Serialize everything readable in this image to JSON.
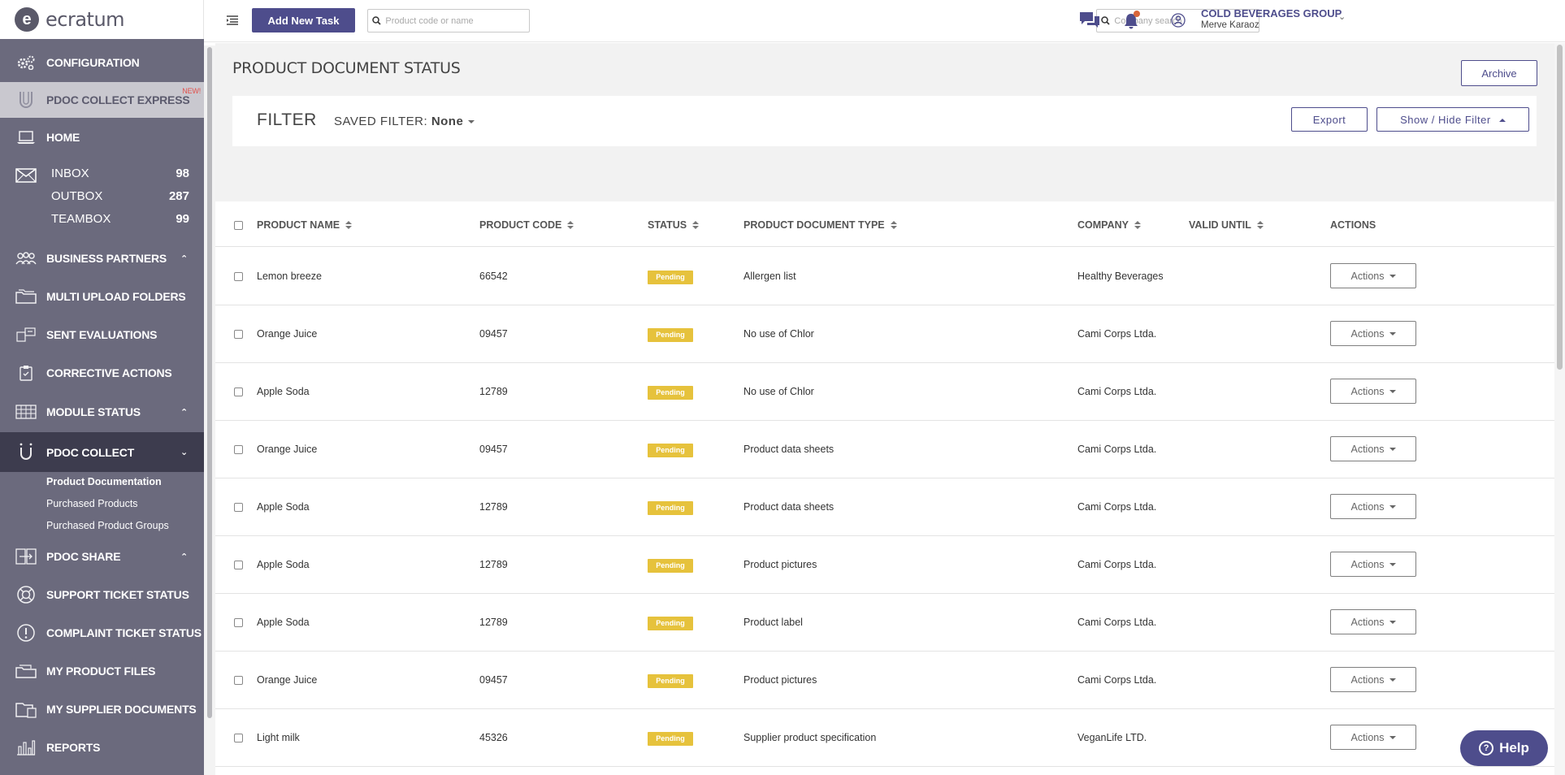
{
  "brand": {
    "logo_letter": "e",
    "logo_text": "ecratum"
  },
  "sidebar": {
    "configuration": "CONFIGURATION",
    "pdoc_express": "PDOC COLLECT EXPRESS",
    "new_badge": "NEW!",
    "home": "HOME",
    "inbox": {
      "label": "INBOX",
      "count": "98"
    },
    "outbox": {
      "label": "OUTBOX",
      "count": "287"
    },
    "teambox": {
      "label": "TEAMBOX",
      "count": "99"
    },
    "business_partners": "BUSINESS PARTNERS",
    "multi_upload": "MULTI UPLOAD FOLDERS",
    "sent_evaluations": "SENT EVALUATIONS",
    "corrective_actions": "CORRECTIVE ACTIONS",
    "module_status": "MODULE STATUS",
    "pdoc_collect": "PDOC COLLECT",
    "sub_product_documentation": "Product Documentation",
    "sub_purchased_products": "Purchased Products",
    "sub_purchased_product_groups": "Purchased Product Groups",
    "pdoc_share": "PDOC SHARE",
    "support_ticket": "SUPPORT TICKET STATUS",
    "complaint_ticket": "COMPLAINT TICKET STATUS",
    "my_product_files": "MY PRODUCT FILES",
    "my_supplier_documents": "MY SUPPLIER DOCUMENTS",
    "reports": "REPORTS"
  },
  "topbar": {
    "add_task": "Add New Task",
    "product_search_placeholder": "Product code or name",
    "company_search_placeholder": "Company search",
    "company_name": "COLD BEVERAGES GROUP",
    "user_name": "Merve Karaoz"
  },
  "page": {
    "title": "PRODUCT DOCUMENT STATUS",
    "archive": "Archive",
    "filter_title": "FILTER",
    "saved_filter_label": "SAVED FILTER:",
    "saved_filter_value": "None",
    "export": "Export",
    "show_hide_filter": "Show / Hide Filter"
  },
  "table": {
    "headers": {
      "product_name": "PRODUCT NAME",
      "product_code": "PRODUCT CODE",
      "status": "STATUS",
      "doc_type": "PRODUCT DOCUMENT TYPE",
      "company": "COMPANY",
      "valid_until": "VALID UNTIL",
      "actions": "ACTIONS"
    },
    "action_label": "Actions",
    "rows": [
      {
        "name": "Lemon breeze",
        "code": "66542",
        "status": "Pending",
        "doc_type": "Allergen list",
        "company": "Healthy Beverages",
        "valid_until": ""
      },
      {
        "name": "Orange Juice",
        "code": "09457",
        "status": "Pending",
        "doc_type": "No use of Chlor",
        "company": "Cami Corps Ltda.",
        "valid_until": ""
      },
      {
        "name": "Apple Soda",
        "code": "12789",
        "status": "Pending",
        "doc_type": "No use of Chlor",
        "company": "Cami Corps Ltda.",
        "valid_until": ""
      },
      {
        "name": "Orange Juice",
        "code": "09457",
        "status": "Pending",
        "doc_type": "Product data sheets",
        "company": "Cami Corps Ltda.",
        "valid_until": ""
      },
      {
        "name": "Apple Soda",
        "code": "12789",
        "status": "Pending",
        "doc_type": "Product data sheets",
        "company": "Cami Corps Ltda.",
        "valid_until": ""
      },
      {
        "name": "Apple Soda",
        "code": "12789",
        "status": "Pending",
        "doc_type": "Product pictures",
        "company": "Cami Corps Ltda.",
        "valid_until": ""
      },
      {
        "name": "Apple Soda",
        "code": "12789",
        "status": "Pending",
        "doc_type": "Product label",
        "company": "Cami Corps Ltda.",
        "valid_until": ""
      },
      {
        "name": "Orange Juice",
        "code": "09457",
        "status": "Pending",
        "doc_type": "Product pictures",
        "company": "Cami Corps Ltda.",
        "valid_until": ""
      },
      {
        "name": "Light milk",
        "code": "45326",
        "status": "Pending",
        "doc_type": "Supplier product specification",
        "company": "VeganLife LTD.",
        "valid_until": ""
      }
    ]
  },
  "help": {
    "label": "Help",
    "glyph": "?"
  },
  "colors": {
    "primary": "#4e4d8c",
    "sidebar": "#6b6a7d",
    "sidebar_active": "#3d3c4e",
    "pending": "#e6c23c"
  },
  "icons": [
    "logo-icon",
    "gears-icon",
    "magnet-icon",
    "laptop-icon",
    "envelope-icon",
    "people-icon",
    "folders-icon",
    "evaluation-icon",
    "clipboard-icon",
    "grid-icon",
    "share-icon",
    "lifebuoy-icon",
    "alert-icon",
    "files-icon",
    "folder-icon",
    "bar-chart-icon",
    "menu-icon",
    "search-icon",
    "chat-icon",
    "bell-icon",
    "user-icon",
    "chevron-down-icon",
    "sort-icon"
  ]
}
